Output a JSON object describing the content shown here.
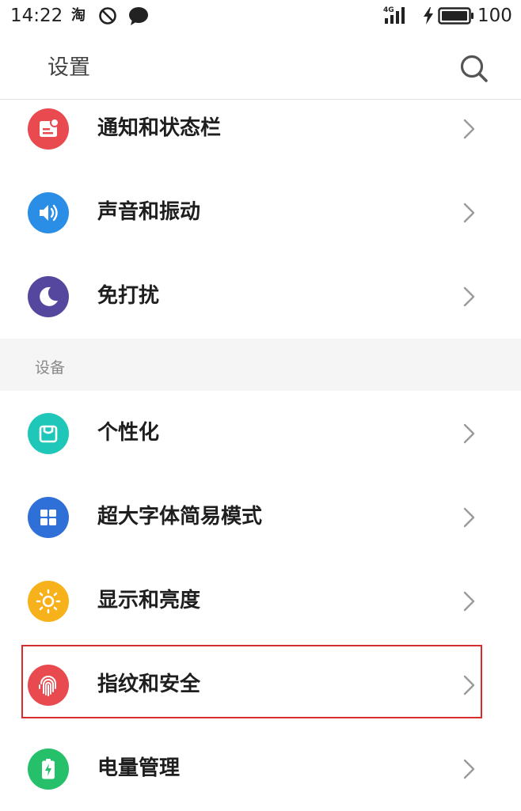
{
  "status_bar": {
    "time": "14:22",
    "taobao": "淘",
    "network": "4G",
    "battery": "100"
  },
  "header": {
    "title": "设置"
  },
  "sections": {
    "device_title": "设备"
  },
  "rows": [
    {
      "label": "通知和状态栏",
      "icon": "notification-icon",
      "color": "#e84a4f"
    },
    {
      "label": "声音和振动",
      "icon": "sound-icon",
      "color": "#2a8ee6"
    },
    {
      "label": "免打扰",
      "icon": "moon-icon",
      "color": "#55479e"
    },
    {
      "label": "个性化",
      "icon": "personalization-icon",
      "color": "#1fc7b8"
    },
    {
      "label": "超大字体简易模式",
      "icon": "grid-icon",
      "color": "#2f6fd8"
    },
    {
      "label": "显示和亮度",
      "icon": "sun-icon",
      "color": "#f7b11a"
    },
    {
      "label": "指纹和安全",
      "icon": "fingerprint-icon",
      "color": "#e84a4f"
    },
    {
      "label": "电量管理",
      "icon": "battery-icon",
      "color": "#26c06a"
    }
  ],
  "highlight_color": "#d92c2c"
}
